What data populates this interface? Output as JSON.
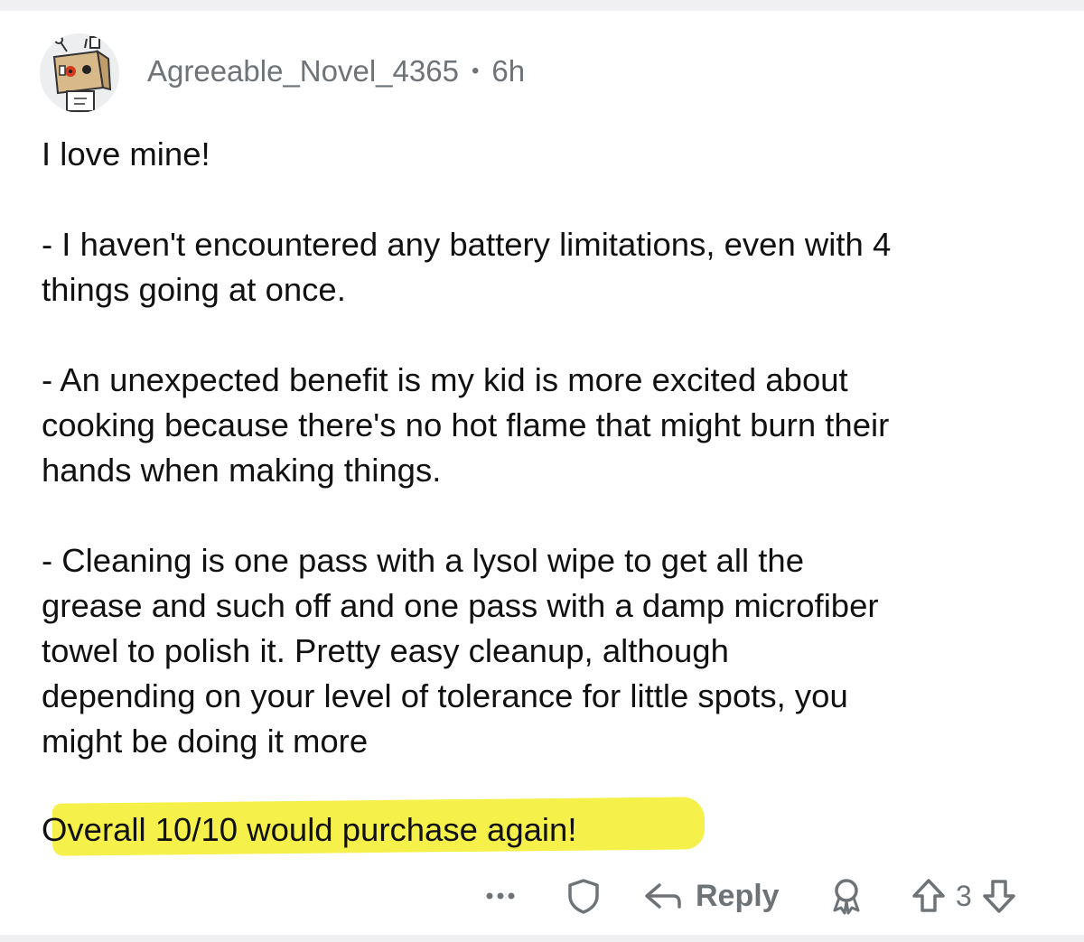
{
  "comment": {
    "username": "Agreeable_Novel_4365",
    "separator": "•",
    "age": "6h",
    "paragraphs": [
      [
        "I love mine!"
      ],
      [
        "- I haven't encountered any battery limitations, even with 4",
        "things going at once."
      ],
      [
        "- An unexpected benefit is my kid is more excited about",
        "cooking because there's no hot flame that might burn their",
        "hands when making things."
      ],
      [
        "- Cleaning is one pass with a lysol wipe to get all the",
        "grease and such off and one pass with a damp microfiber",
        "towel to polish it.  Pretty easy cleanup, although",
        "depending on your level of tolerance for little spots, you",
        "might be doing it more"
      ],
      [
        "Overall 10/10 would purchase again!"
      ]
    ]
  },
  "actions": {
    "more_icon": "ellipsis-icon",
    "save_icon": "shield-icon",
    "reply_icon": "reply-arrow-icon",
    "reply_label": "Reply",
    "award_icon": "award-icon",
    "upvote_icon": "upvote-arrow-icon",
    "vote_count": "3",
    "downvote_icon": "downvote-arrow-icon"
  },
  "colors": {
    "highlight": "#f5f04a",
    "meta_text": "#6e7378",
    "body_text": "#111111",
    "bar_background": "#f0f0f3"
  }
}
